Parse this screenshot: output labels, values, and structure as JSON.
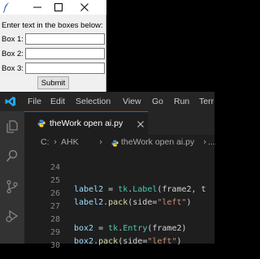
{
  "tk_window": {
    "prompt": "Enter text in the boxes below:",
    "boxes": [
      {
        "label": "Box 1:",
        "value": ""
      },
      {
        "label": "Box 2:",
        "value": ""
      },
      {
        "label": "Box 3:",
        "value": ""
      }
    ],
    "submit_label": "Submit"
  },
  "vscode": {
    "menu": [
      "File",
      "Edit",
      "Selection",
      "View",
      "Go",
      "Run",
      "Terr"
    ],
    "tab": {
      "label": "theWork open ai.py",
      "close": "×"
    },
    "breadcrumb": {
      "part1": "C:",
      "part2": "AHK",
      "part3": "theWork open ai.py",
      "part4": "..."
    },
    "code": {
      "lines": [
        {
          "num": "24"
        },
        {
          "num": "25",
          "var": "label2",
          "eq": " = ",
          "mod": "tk",
          "dot": ".",
          "fn": "Label",
          "args": "(frame2, t"
        },
        {
          "num": "26",
          "var": "label2",
          "dot": ".",
          "fn": "pack",
          "args_open": "(side=",
          "str": "\"left\"",
          "args_close": ")"
        },
        {
          "num": "27"
        },
        {
          "num": "28",
          "var": "box2",
          "eq": " = ",
          "mod": "tk",
          "dot": ".",
          "fn": "Entry",
          "args": "(frame2)"
        },
        {
          "num": "29",
          "var": "box2",
          "dot": ".",
          "fn": "pack",
          "args_open": "(side=",
          "str": "\"left\"",
          "args_close": ")"
        },
        {
          "num": "30"
        }
      ]
    }
  }
}
